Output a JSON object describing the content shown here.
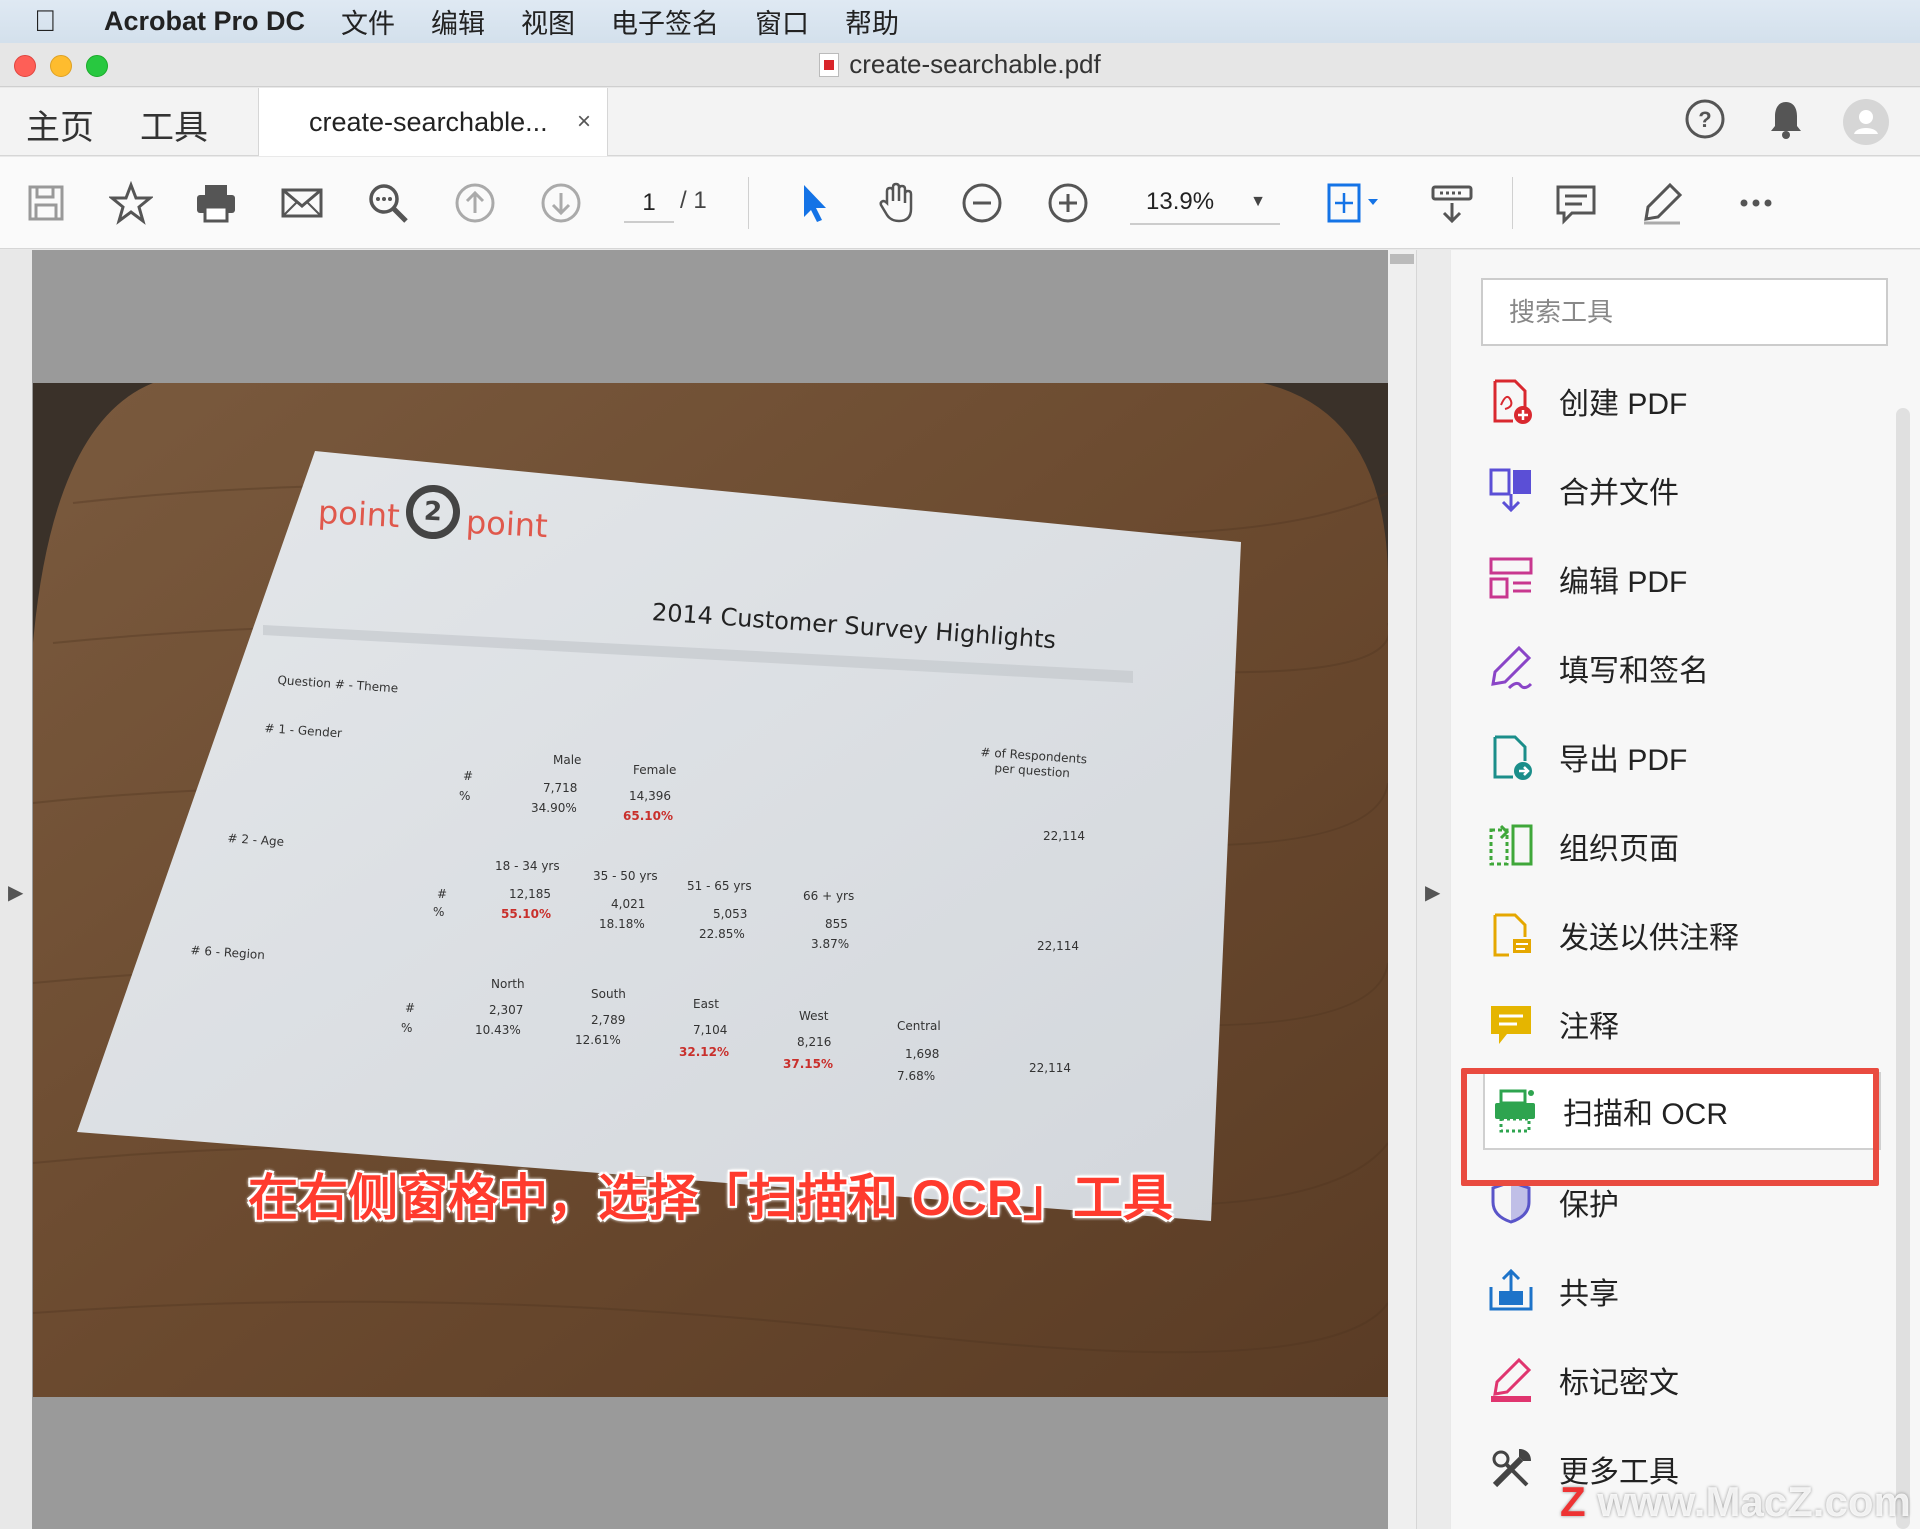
{
  "menubar": {
    "app": "Acrobat Pro DC",
    "items": [
      "文件",
      "编辑",
      "视图",
      "电子签名",
      "窗口",
      "帮助"
    ]
  },
  "window": {
    "title": "create-searchable.pdf"
  },
  "tabs": {
    "home": "主页",
    "tools": "工具",
    "document": "create-searchable...",
    "close": "×"
  },
  "toolbar": {
    "page_current": "1",
    "page_total": "/ 1",
    "zoom": "13.9%"
  },
  "document": {
    "logo_left": "point",
    "logo_num": "2",
    "logo_right": "point",
    "sheet_title": "2014 Customer Survey Highlights",
    "question_theme": "Question # - Theme",
    "respondents_header_1": "# of Respondents",
    "respondents_header_2": "per question",
    "q1": {
      "label": "# 1 - Gender",
      "row_count": "#",
      "row_pct": "%",
      "cols": [
        {
          "name": "Male",
          "count": "7,718",
          "pct": "34.90%"
        },
        {
          "name": "Female",
          "count": "14,396",
          "pct": "65.10%"
        }
      ],
      "total": "22,114"
    },
    "q2": {
      "label": "# 2 - Age",
      "row_count": "#",
      "row_pct": "%",
      "cols": [
        {
          "name": "18 - 34 yrs",
          "count": "12,185",
          "pct": "55.10%"
        },
        {
          "name": "35 - 50 yrs",
          "count": "4,021",
          "pct": "18.18%"
        },
        {
          "name": "51 - 65 yrs",
          "count": "5,053",
          "pct": "22.85%"
        },
        {
          "name": "66 + yrs",
          "count": "855",
          "pct": "3.87%"
        }
      ],
      "total": "22,114"
    },
    "q6": {
      "label": "# 6 - Region",
      "row_count": "#",
      "row_pct": "%",
      "cols": [
        {
          "name": "North",
          "count": "2,307",
          "pct": "10.43%"
        },
        {
          "name": "South",
          "count": "2,789",
          "pct": "12.61%"
        },
        {
          "name": "East",
          "count": "7,104",
          "pct": "32.12%"
        },
        {
          "name": "West",
          "count": "8,216",
          "pct": "37.15%"
        },
        {
          "name": "Central",
          "count": "1,698",
          "pct": "7.68%"
        }
      ],
      "total": "22,114"
    }
  },
  "caption": "在右侧窗格中，选择「扫描和 OCR」工具",
  "right_panel": {
    "search_placeholder": "搜索工具",
    "tools": [
      {
        "label": "创建 PDF",
        "icon": "create-pdf-icon",
        "color": "#d9282f"
      },
      {
        "label": "合并文件",
        "icon": "combine-files-icon",
        "color": "#5b4fd6"
      },
      {
        "label": "编辑 PDF",
        "icon": "edit-pdf-icon",
        "color": "#c8378f"
      },
      {
        "label": "填写和签名",
        "icon": "fill-sign-icon",
        "color": "#8a45c7"
      },
      {
        "label": "导出 PDF",
        "icon": "export-pdf-icon",
        "color": "#1b8e8a"
      },
      {
        "label": "组织页面",
        "icon": "organize-pages-icon",
        "color": "#3fa73a"
      },
      {
        "label": "发送以供注释",
        "icon": "send-for-comments-icon",
        "color": "#e5a700"
      },
      {
        "label": "注释",
        "icon": "comment-icon",
        "color": "#e5b500"
      },
      {
        "label": "扫描和 OCR",
        "icon": "scan-ocr-icon",
        "color": "#2ea44f"
      },
      {
        "label": "保护",
        "icon": "protect-icon",
        "color": "#5a55c9"
      },
      {
        "label": "共享",
        "icon": "share-icon",
        "color": "#1d73c9"
      },
      {
        "label": "标记密文",
        "icon": "redact-icon",
        "color": "#e0356f"
      },
      {
        "label": "更多工具",
        "icon": "more-tools-icon",
        "color": "#444444"
      }
    ]
  },
  "watermark": {
    "z": "Z",
    "text": "www.MacZ.com"
  }
}
